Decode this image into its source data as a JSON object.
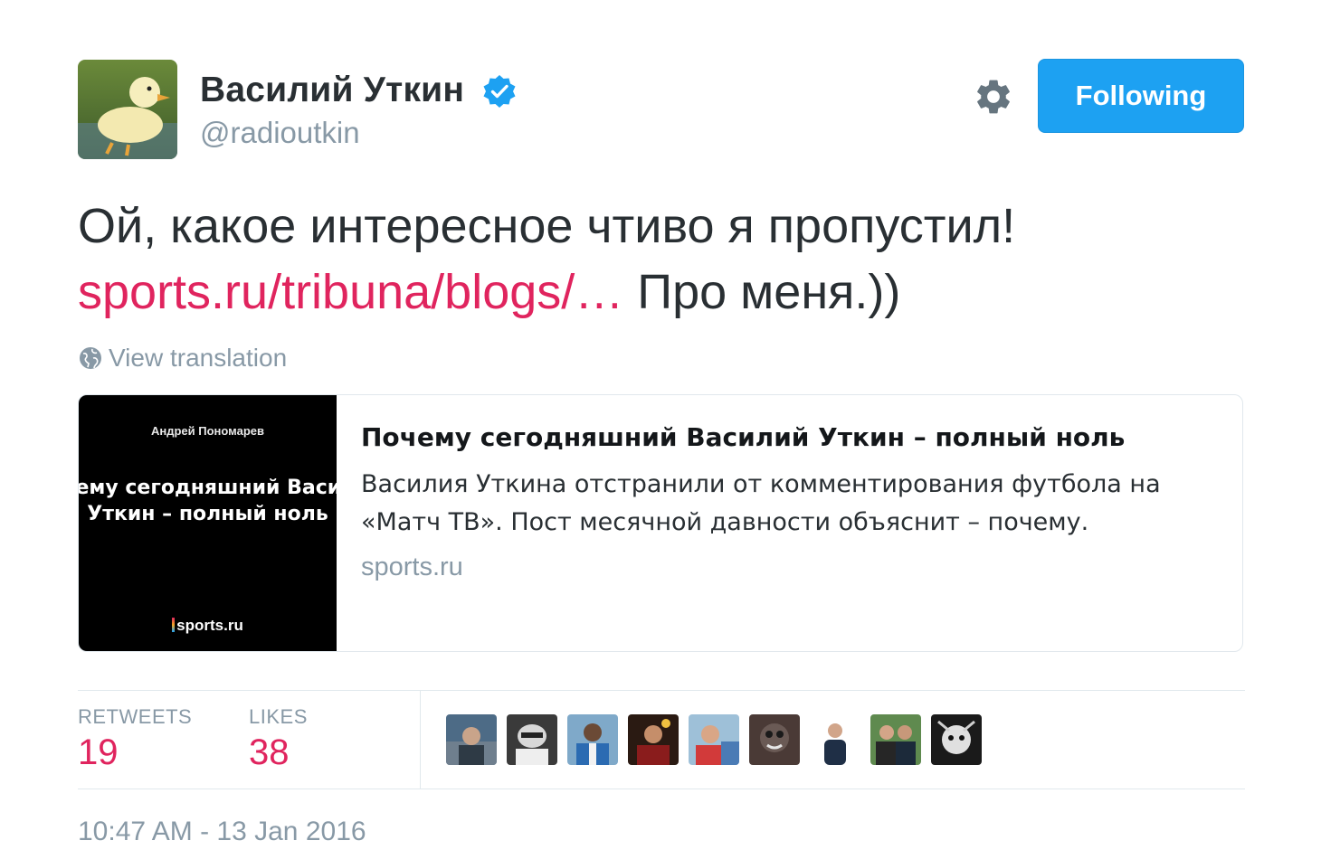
{
  "user": {
    "display_name": "Василий Уткин",
    "handle": "@radioutkin",
    "verified": true
  },
  "header": {
    "follow_label": "Following"
  },
  "tweet": {
    "text_before": "Ой, какое интересное чтиво я пропустил!",
    "link_text": "sports.ru/tribuna/blogs/…",
    "text_after": " Про меня.))",
    "translate_label": "View translation"
  },
  "card": {
    "image": {
      "author": "Андрей Пономарев",
      "title": "Почему сегодняшний Василий Уткин – полный ноль",
      "brand": "sports.ru"
    },
    "title": "Почему сегодняшний Василий Уткин – полный ноль",
    "description": "Василия Уткина отстранили от комментирования футбола на «Матч ТВ». Пост месячной давности объяснит – почему.",
    "domain": "sports.ru"
  },
  "stats": {
    "retweets_label": "RETWEETS",
    "retweets": "19",
    "likes_label": "LIKES",
    "likes": "38"
  },
  "timestamp": "10:47 AM - 13 Jan 2016",
  "colors": {
    "accent": "#1da1f2",
    "link": "#e0245e",
    "muted": "#8899a6"
  }
}
